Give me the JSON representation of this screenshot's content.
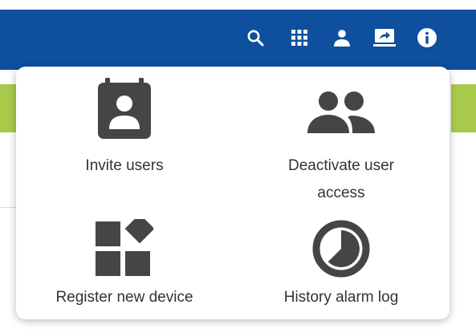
{
  "colors": {
    "topbar": "#0e4f9e",
    "accent_green": "#a8c94a",
    "icon_gray": "#454545",
    "label_text": "#333333"
  },
  "topbar": {
    "icons": [
      "search-icon",
      "apps-grid-icon",
      "person-icon",
      "screen-share-icon",
      "info-icon"
    ]
  },
  "menu": {
    "items": [
      {
        "label": "Invite users",
        "icon": "contact-calendar-icon"
      },
      {
        "label": "Deactivate user access",
        "icon": "people-icon"
      },
      {
        "label": "Register new device",
        "icon": "widgets-icon"
      },
      {
        "label": "History alarm log",
        "icon": "pie-clock-icon"
      }
    ]
  }
}
